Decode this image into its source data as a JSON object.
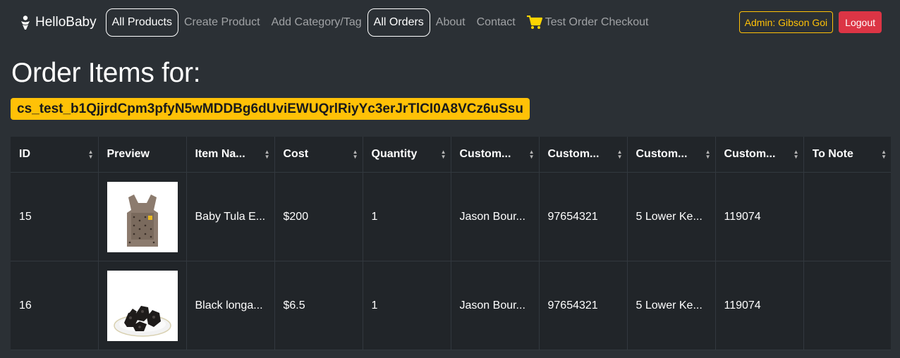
{
  "nav": {
    "brand": "HelloBaby",
    "links": [
      {
        "label": "All Products",
        "active": true
      },
      {
        "label": "Create Product",
        "active": false
      },
      {
        "label": "Add Category/Tag",
        "active": false
      },
      {
        "label": "All Orders",
        "active": true
      },
      {
        "label": "About",
        "active": false
      },
      {
        "label": "Contact",
        "active": false
      },
      {
        "label": "Test Order Checkout",
        "active": false,
        "icon": "cart-icon"
      }
    ],
    "admin_label": "Admin: Gibson Goi",
    "logout_label": "Logout"
  },
  "page": {
    "title": "Order Items for:",
    "session_id": "cs_test_b1QjjrdCpm3pfyN5wMDDBg6dUviEWUQrlRiyYc3erJrTlCI0A8VCz6uSsu"
  },
  "table": {
    "headers": [
      "ID",
      "Preview",
      "Item Na...",
      "Cost",
      "Quantity",
      "Custom...",
      "Custom...",
      "Custom...",
      "Custom...",
      "To Note"
    ],
    "rows": [
      {
        "id": "15",
        "preview": "baby-carrier-image",
        "item_name": "Baby Tula E...",
        "cost": "$200",
        "quantity": "1",
        "customer_name": "Jason Bour...",
        "customer_phone": "97654321",
        "customer_address": "5 Lower Ke...",
        "customer_postal": "119074",
        "to_note": ""
      },
      {
        "id": "16",
        "preview": "black-longan-image",
        "item_name": "Black longa...",
        "cost": "$6.5",
        "quantity": "1",
        "customer_name": "Jason Bour...",
        "customer_phone": "97654321",
        "customer_address": "5 Lower Ke...",
        "customer_postal": "119074",
        "to_note": ""
      }
    ]
  },
  "colors": {
    "background": "#2b3035",
    "table_background": "#212529",
    "warning": "#ffc107",
    "danger": "#dc3545",
    "cart_icon": "#ffd500"
  }
}
